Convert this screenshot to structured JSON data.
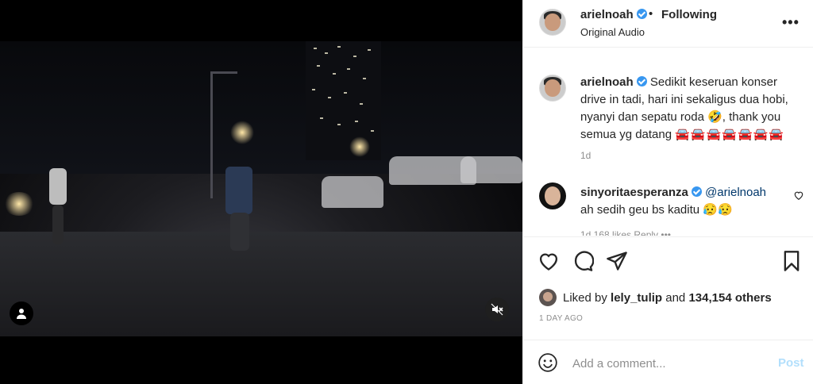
{
  "post": {
    "username": "arielnoah",
    "separator": "•",
    "follow_label": "Following",
    "audio_label": "Original Audio",
    "more_label": "•••"
  },
  "caption": {
    "username": "arielnoah",
    "text": "Sedikit keseruan konser drive in tadi, hari ini sekaligus dua hobi, nyanyi dan sepatu roda 🤣, thank you semua yg datang",
    "cars": "🚘🚘🚘🚘🚘🚘🚘",
    "time": "1d"
  },
  "comment": {
    "username": "sinyoritaesperanza",
    "mention": "@arielnoah",
    "text": "ah sedih geu bs kaditu 😥😥",
    "meta": "1d   168 likes   Reply   •••"
  },
  "likes": {
    "prefix": "Liked by",
    "user": "lely_tulip",
    "middle": "and",
    "count": "134,154 others"
  },
  "posted_ago": "1 DAY AGO",
  "composer": {
    "placeholder": "Add a comment...",
    "post_label": "Post"
  },
  "colors": {
    "verified": "#3897f0",
    "link": "#00376b",
    "post_disabled": "#b2dffc",
    "muted": "#8e8e8e"
  }
}
